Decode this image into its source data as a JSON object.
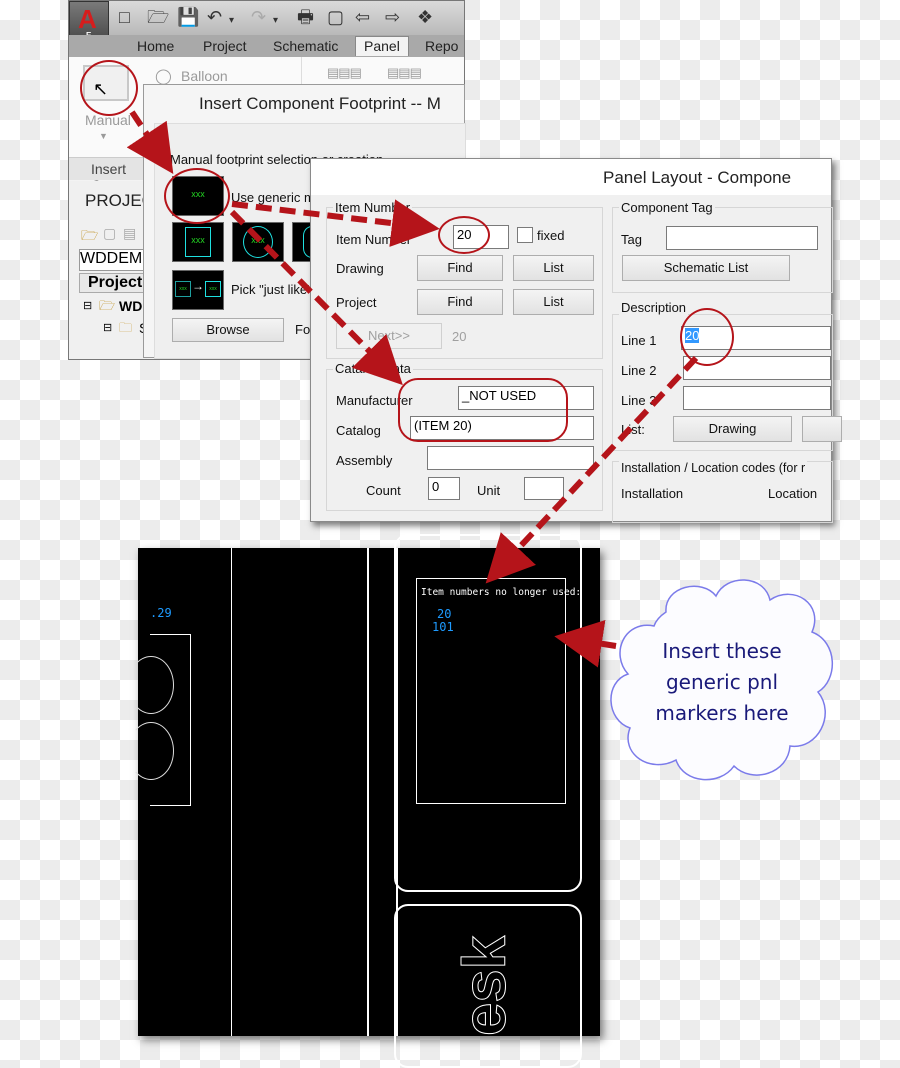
{
  "acad": {
    "app_letter": "A",
    "app_sub": "E",
    "qat_icons": [
      "new-icon",
      "open-icon",
      "save-icon",
      "undo-icon",
      "redo-icon",
      "plot-icon",
      "sheet-icon",
      "back-icon",
      "forward-icon",
      "tree-icon"
    ],
    "tabs": [
      {
        "label": "Home",
        "active": false
      },
      {
        "label": "Project",
        "active": false
      },
      {
        "label": "Schematic",
        "active": false
      },
      {
        "label": "Panel",
        "active": true
      },
      {
        "label": "Repo",
        "active": false
      }
    ],
    "ribbon": {
      "manual_label": "Manual",
      "balloon_label": "Balloon",
      "panel_label": "Insert Co"
    },
    "project_palette": {
      "title": "PROJEC",
      "project_dropdown": "WDDEM",
      "tree_header": "Project",
      "tree_root": "WD",
      "tree_child": "S"
    }
  },
  "insert_footprint": {
    "title": "Insert Component Footprint -- M",
    "section_label": "Manual footprint selection or creation",
    "generic_label": "Use generic m",
    "pick_just_like": "Pick \"just like\"",
    "thumb_text": "xxx",
    "browse_button": "Browse",
    "footprint_label": "Fo"
  },
  "panel_layout": {
    "title": "Panel Layout - Compone",
    "item_number_group": "Item Number",
    "item_number_label": "Item Number",
    "item_number_value": "20",
    "fixed_label": "fixed",
    "fixed_checked": false,
    "drawing_label": "Drawing",
    "project_label": "Project",
    "find_label": "Find",
    "list_label": "List",
    "next_button": "Next>>",
    "next_value": "20",
    "catalog_group": "Catalog Data",
    "manufacturer_label": "Manufacturer",
    "manufacturer_value": "_NOT USED",
    "catalog_label": "Catalog",
    "catalog_value": "(ITEM 20)",
    "assembly_label": "Assembly",
    "assembly_value": "",
    "count_label": "Count",
    "count_value": "0",
    "unit_label": "Unit",
    "unit_value": "",
    "component_tag_group": "Component Tag",
    "tag_label": "Tag",
    "tag_value": "",
    "schematic_list_button": "Schematic List",
    "description_group": "Description",
    "line1_label": "Line 1",
    "line1_value": "20",
    "line2_label": "Line 2",
    "line2_value": "",
    "line3_label": "Line 3",
    "line3_value": "",
    "list_row_label": "List:",
    "drawing_button": "Drawing",
    "install_group": "Installation / Location codes  (for r",
    "installation_label": "Installation",
    "location_label": "Location"
  },
  "cad_drawing": {
    "tag_fragment": ".29",
    "box_title": "Item numbers no longer used:",
    "unused_items": [
      "20",
      "101"
    ],
    "logo_fragment": "esk"
  },
  "callout": {
    "lines": [
      "Insert these",
      "generic pnl",
      "markers here"
    ]
  },
  "colors": {
    "annotation_red": "#b5141a",
    "cad_text_blue": "#1e9bff",
    "callout_border": "#7b7bea",
    "callout_text": "#1a1a7a",
    "selection_blue": "#3399ff"
  }
}
